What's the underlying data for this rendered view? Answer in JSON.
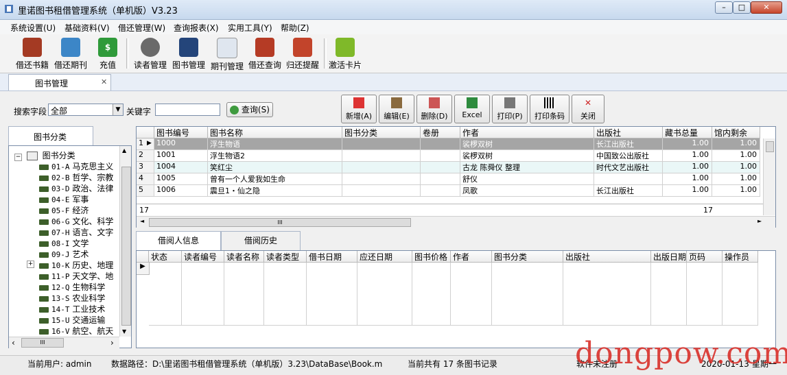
{
  "window": {
    "title": "里诺图书租借管理系统（单机版）V3.23",
    "min": "–",
    "max": "□",
    "close": "✕"
  },
  "menu": [
    "系统设置(U)",
    "基础资料(V)",
    "借还管理(W)",
    "查询报表(X)",
    "实用工具(Y)",
    "帮助(Z)"
  ],
  "toolbar": [
    "借还书籍",
    "借还期刊",
    "充值",
    "读者管理",
    "图书管理",
    "期刊管理",
    "借还查询",
    "归还提醒",
    "激活卡片"
  ],
  "doc_tab": {
    "label": "图书管理",
    "close": "✕"
  },
  "search": {
    "field_label": "搜索字段",
    "field_value": "全部",
    "keyword_label": "关键字",
    "keyword_value": "",
    "query_btn": "查询(S)"
  },
  "actions": [
    "新增(A)",
    "编辑(E)",
    "删除(D)",
    "Excel",
    "打印(P)",
    "打印条码",
    "关闭"
  ],
  "tree": {
    "tab": "图书分类",
    "root": "图书分类",
    "nodes": [
      {
        "code": "01-A",
        "name": "马克思主义"
      },
      {
        "code": "02-B",
        "name": "哲学、宗教"
      },
      {
        "code": "03-D",
        "name": "政治、法律"
      },
      {
        "code": "04-E",
        "name": "军事"
      },
      {
        "code": "05-F",
        "name": "经济"
      },
      {
        "code": "06-G",
        "name": "文化、科学"
      },
      {
        "code": "07-H",
        "name": "语言、文字"
      },
      {
        "code": "08-I",
        "name": "文学"
      },
      {
        "code": "09-J",
        "name": "艺术"
      },
      {
        "code": "10-K",
        "name": "历史、地理"
      },
      {
        "code": "11-P",
        "name": "天文学、地"
      },
      {
        "code": "12-Q",
        "name": "生物科学"
      },
      {
        "code": "13-S",
        "name": "农业科学"
      },
      {
        "code": "14-T",
        "name": "工业技术"
      },
      {
        "code": "15-U",
        "name": "交通运输"
      },
      {
        "code": "16-V",
        "name": "航空、航天"
      }
    ],
    "scroll_left": "‹",
    "scroll_right": "›",
    "scroll_thumb": "III"
  },
  "books": {
    "columns": [
      "图书编号",
      "图书名称",
      "图书分类",
      "卷册",
      "作者",
      "出版社",
      "藏书总量",
      "馆内剩余"
    ],
    "rows": [
      {
        "n": "1",
        "id": "1000",
        "name": "浮生物语",
        "cat": "",
        "vol": "",
        "author": "裟椤双树",
        "pub": "长江出版社",
        "total": "1.00",
        "remain": "1.00"
      },
      {
        "n": "2",
        "id": "1001",
        "name": "浮生物语2",
        "cat": "",
        "vol": "",
        "author": "裟椤双树",
        "pub": "中国致公出版社",
        "total": "1.00",
        "remain": "1.00"
      },
      {
        "n": "3",
        "id": "1004",
        "name": "笑红尘",
        "cat": "",
        "vol": "",
        "author": "古龙 陈舜仪 整理",
        "pub": "时代文艺出版社",
        "total": "1.00",
        "remain": "1.00"
      },
      {
        "n": "4",
        "id": "1005",
        "name": "曾有一个人爱我如生命",
        "cat": "",
        "vol": "",
        "author": "舒仪",
        "pub": "",
        "total": "1.00",
        "remain": "1.00"
      },
      {
        "n": "5",
        "id": "1006",
        "name": "震旦1・仙之隐",
        "cat": "",
        "vol": "",
        "author": "凤歌",
        "pub": "长江出版社",
        "total": "1.00",
        "remain": "1.00"
      }
    ],
    "footer_count": "17",
    "footer_total": "17",
    "hscroll_thumb": "III"
  },
  "lower_tabs": [
    "借阅人信息",
    "借阅历史"
  ],
  "borrow": {
    "columns": [
      "状态",
      "读者编号",
      "读者名称",
      "读者类型",
      "借书日期",
      "应还日期",
      "图书价格",
      "作者",
      "图书分类",
      "出版社",
      "出版日期",
      "页码",
      "操作员"
    ]
  },
  "status": {
    "user": "当前用户: admin",
    "path": "数据路径：D:\\里诺图书租借管理系统（单机版）3.23\\DataBase\\Book.mdb",
    "count": "当前共有 17 条图书记录",
    "unreg": "软件未注册",
    "date": "2020-01-13",
    "ver": "星期一"
  },
  "watermark": "dongpow.com"
}
